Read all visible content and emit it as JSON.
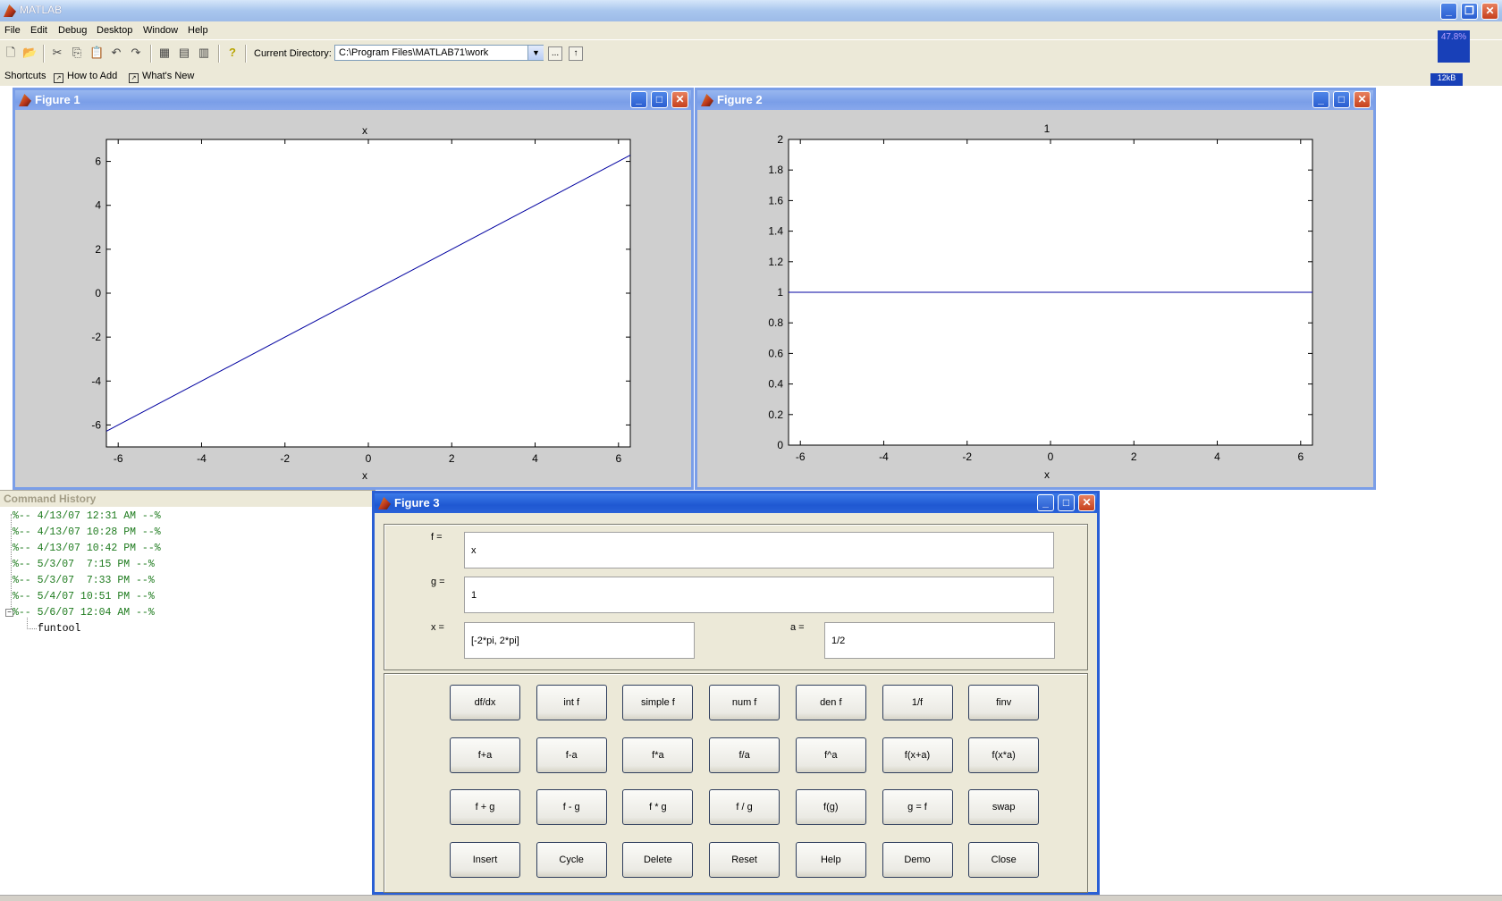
{
  "app": {
    "title": "MATLAB"
  },
  "menu": [
    "File",
    "Edit",
    "Debug",
    "Desktop",
    "Window",
    "Help"
  ],
  "toolbar": {
    "current_directory_label": "Current Directory:",
    "current_directory_value": "C:\\Program Files\\MATLAB71\\work",
    "browse_label": "...",
    "up_label": "↑"
  },
  "shortcuts": {
    "label": "Shortcuts",
    "how_to_add": "How to Add",
    "whats_new": "What's New"
  },
  "monitor": {
    "cpu": "47.8%",
    "net": "12kB"
  },
  "command_history": {
    "title": "Command History",
    "entries": [
      "%-- 4/13/07 12:31 AM --%",
      "%-- 4/13/07 10:28 PM --%",
      "%-- 4/13/07 10:42 PM --%",
      "%-- 5/3/07  7:15 PM --%",
      "%-- 5/3/07  7:33 PM --%",
      "%-- 5/4/07 10:51 PM --%",
      "%-- 5/6/07 12:04 AM --%"
    ],
    "child": "funtool"
  },
  "figure1": {
    "title": "Figure 1",
    "plot_title": "x",
    "xlabel": "x",
    "xticks": [
      "-6",
      "-4",
      "-2",
      "0",
      "2",
      "4",
      "6"
    ],
    "yticks": [
      "6",
      "4",
      "2",
      "0",
      "-2",
      "-4",
      "-6"
    ]
  },
  "figure2": {
    "title": "Figure 2",
    "plot_title": "1",
    "xlabel": "x",
    "xticks": [
      "-6",
      "-4",
      "-2",
      "0",
      "2",
      "4",
      "6"
    ],
    "yticks": [
      "2",
      "1.8",
      "1.6",
      "1.4",
      "1.2",
      "1",
      "0.8",
      "0.6",
      "0.4",
      "0.2",
      "0"
    ]
  },
  "chart_data": [
    {
      "type": "line",
      "title": "x",
      "xlabel": "x",
      "ylabel": "",
      "xlim": [
        -6.2832,
        6.2832
      ],
      "ylim": [
        -7,
        7
      ],
      "series": [
        {
          "x": [
            -6.2832,
            6.2832
          ],
          "y": [
            -6.2832,
            6.2832
          ]
        }
      ],
      "grid": false
    },
    {
      "type": "line",
      "title": "1",
      "xlabel": "x",
      "ylabel": "",
      "xlim": [
        -6.2832,
        6.2832
      ],
      "ylim": [
        0,
        2
      ],
      "series": [
        {
          "x": [
            -6.2832,
            6.2832
          ],
          "y": [
            1,
            1
          ]
        }
      ],
      "grid": false
    }
  ],
  "figure3": {
    "title": "Figure 3",
    "f_label": "f =",
    "f_value": "x",
    "g_label": "g =",
    "g_value": "1",
    "x_label": "x =",
    "x_value": "[-2*pi, 2*pi]",
    "a_label": "a =",
    "a_value": "1/2",
    "buttons": [
      [
        "df/dx",
        "int f",
        "simple f",
        "num f",
        "den f",
        "1/f",
        "finv"
      ],
      [
        "f+a",
        "f-a",
        "f*a",
        "f/a",
        "f^a",
        "f(x+a)",
        "f(x*a)"
      ],
      [
        "f + g",
        "f - g",
        "f * g",
        "f / g",
        "f(g)",
        "g = f",
        "swap"
      ],
      [
        "Insert",
        "Cycle",
        "Delete",
        "Reset",
        "Help",
        "Demo",
        "Close"
      ]
    ]
  }
}
